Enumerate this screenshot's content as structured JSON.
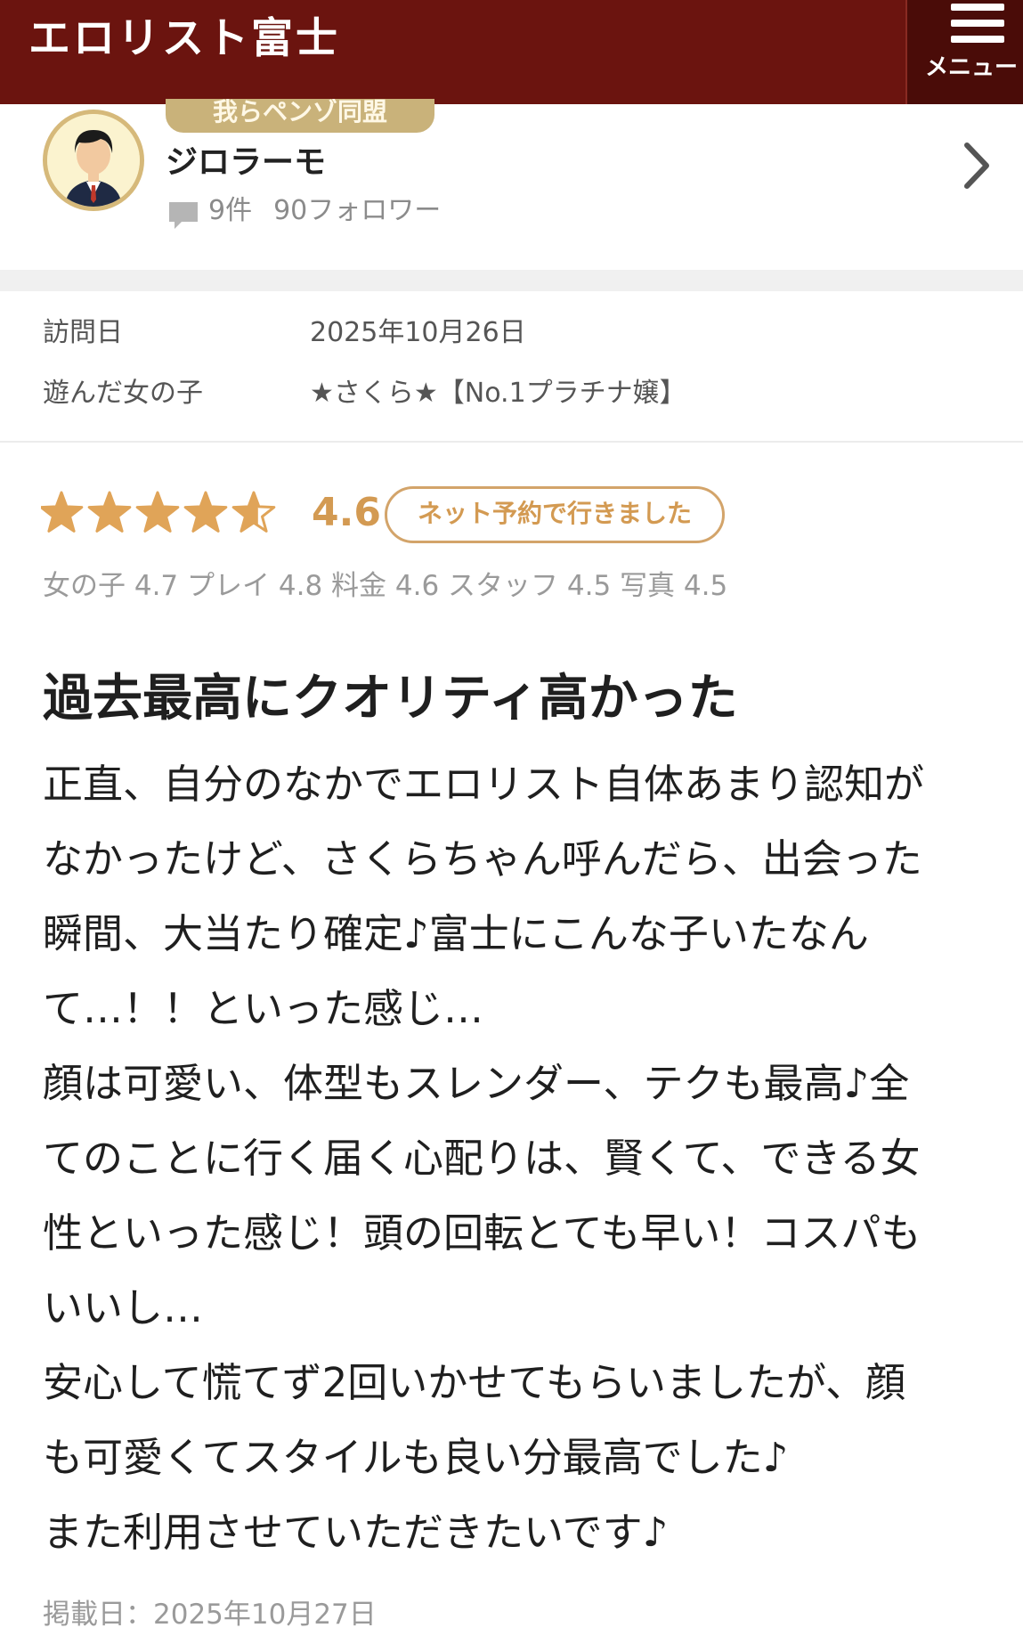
{
  "header": {
    "site_title": "エロリスト富士",
    "menu_label": "メニュー"
  },
  "reviewer": {
    "rank_badge": "我らペンゾ同盟",
    "name": "ジロラーモ",
    "post_count": "9件",
    "followers": "90フォロワー"
  },
  "visit": {
    "date_label": "訪問日",
    "date_value": "2025年10月26日",
    "girl_label": "遊んだ女の子",
    "girl_value": "★さくら★【No.1プラチナ嬢】"
  },
  "rating": {
    "score": "4.6",
    "stars_value": 4.6,
    "stars_max": 5,
    "reservation_badge": "ネット予約で行きました",
    "sub_ratings": "女の子 4.7 プレイ 4.8 料金 4.6 スタッフ 4.5 写真 4.5"
  },
  "review": {
    "title": "過去最高にクオリティ高かった",
    "lines": [
      "正直、自分のなかでエロリスト自体あまり認知が",
      "なかったけど、さくらちゃん呼んだら、出会った",
      "瞬間、大当たり確定♪富士にこんな子いたなん",
      "て…！！といった感じ…",
      "顔は可愛い、体型もスレンダー、テクも最高♪全",
      "てのことに行く届く心配りは、賢くて、できる女",
      "性といった感じ！頭の回転とても早い！コスパも",
      "いいし…",
      "安心して慌てず2回いかせてもらいましたが、顔",
      "も可愛くてスタイルも良い分最高でした♪",
      "また利用させていただきたいです♪"
    ],
    "posted_date": "掲載日：2025年10月27日"
  },
  "colors": {
    "header_bg": "#6b140f",
    "menu_bg": "#4a0c08",
    "accent_gold": "#d39a52",
    "star_fill": "#e0a458",
    "badge_gold": "#c9b27a"
  }
}
